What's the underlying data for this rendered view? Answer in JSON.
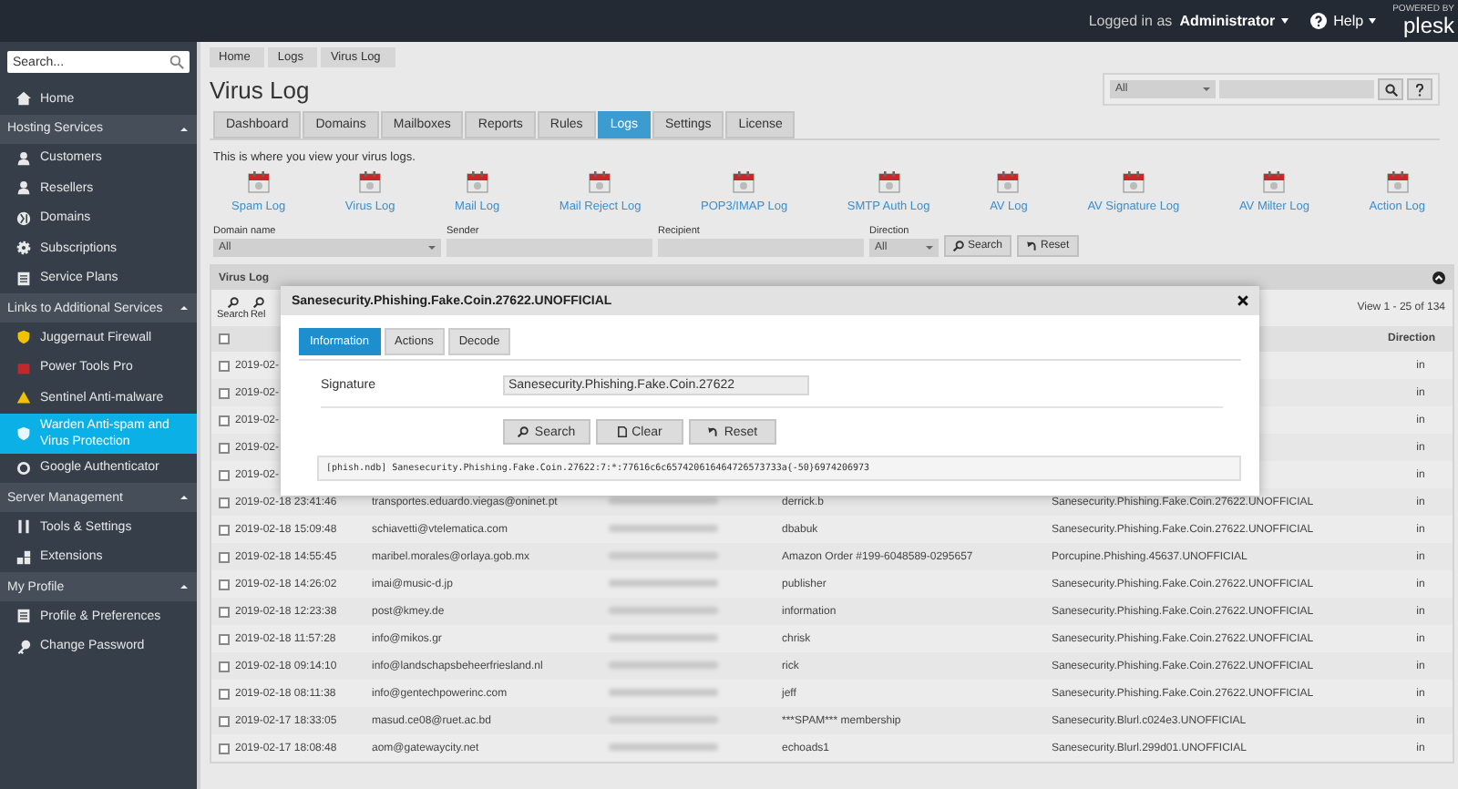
{
  "topbar": {
    "logged_in_label": "Logged in as",
    "user": "Administrator",
    "help": "Help",
    "logo_caption": "POWERED BY",
    "logo": "plesk"
  },
  "sidebar": {
    "search_placeholder": "Search...",
    "items": [
      {
        "kind": "item",
        "label": "Home",
        "selected": false
      },
      {
        "kind": "section",
        "label": "Hosting Services",
        "expanded": true
      },
      {
        "kind": "item",
        "label": "Customers",
        "selected": false
      },
      {
        "kind": "item",
        "label": "Resellers",
        "selected": false
      },
      {
        "kind": "item",
        "label": "Domains",
        "selected": false
      },
      {
        "kind": "item",
        "label": "Subscriptions",
        "selected": false
      },
      {
        "kind": "item",
        "label": "Service Plans",
        "selected": false
      },
      {
        "kind": "section",
        "label": "Links to Additional Services",
        "expanded": true
      },
      {
        "kind": "item",
        "label": "Juggernaut Firewall",
        "selected": false
      },
      {
        "kind": "item",
        "label": "Power Tools Pro",
        "selected": false
      },
      {
        "kind": "item",
        "label": "Sentinel Anti-malware",
        "selected": false
      },
      {
        "kind": "item",
        "label": "Warden Anti-spam and Virus Protection",
        "selected": true
      },
      {
        "kind": "item",
        "label": "Google Authenticator",
        "selected": false
      },
      {
        "kind": "section",
        "label": "Server Management",
        "expanded": true
      },
      {
        "kind": "item",
        "label": "Tools & Settings",
        "selected": false
      },
      {
        "kind": "item",
        "label": "Extensions",
        "selected": false
      },
      {
        "kind": "section",
        "label": "My Profile",
        "expanded": true
      },
      {
        "kind": "item",
        "label": "Profile & Preferences",
        "selected": false
      },
      {
        "kind": "item",
        "label": "Change Password",
        "selected": false
      }
    ]
  },
  "breadcrumb": [
    "Home",
    "Logs",
    "Virus Log"
  ],
  "title": "Virus Log",
  "top_search": {
    "select_value": "All"
  },
  "tabs": [
    {
      "label": "Dashboard",
      "selected": false
    },
    {
      "label": "Domains",
      "selected": false
    },
    {
      "label": "Mailboxes",
      "selected": false
    },
    {
      "label": "Reports",
      "selected": false
    },
    {
      "label": "Rules",
      "selected": false
    },
    {
      "label": "Logs",
      "selected": true
    },
    {
      "label": "Settings",
      "selected": false
    },
    {
      "label": "License",
      "selected": false
    }
  ],
  "description": "This is where you view your virus logs.",
  "log_links": [
    "Spam Log",
    "Virus Log",
    "Mail Log",
    "Mail Reject Log",
    "POP3/IMAP Log",
    "SMTP Auth Log",
    "AV Log",
    "AV Signature Log",
    "AV Milter Log",
    "Action Log"
  ],
  "filters": [
    {
      "kind": "select",
      "label": "Domain name",
      "value": "All"
    },
    {
      "kind": "text",
      "label": "Sender"
    },
    {
      "kind": "text",
      "label": "Recipient"
    },
    {
      "kind": "select",
      "label": "Direction",
      "value": "All"
    }
  ],
  "filter_buttons": [
    "Search",
    "Reset"
  ],
  "table": {
    "title": "Virus Log",
    "toolbar": [
      "Search",
      "Rel"
    ],
    "pager": "View 1 - 25 of 134",
    "direction_header": "Direction",
    "select_all_checked": false,
    "rows": [
      {
        "checked": false,
        "date": "2019-02-",
        "direction": "in"
      },
      {
        "checked": false,
        "date": "2019-02-",
        "direction": "in"
      },
      {
        "checked": false,
        "date": "2019-02-",
        "direction": "in"
      },
      {
        "checked": false,
        "date": "2019-02-",
        "direction": "in"
      },
      {
        "checked": false,
        "date": "2019-02-",
        "direction": "in"
      },
      {
        "checked": false,
        "date": "2019-02-18 23:41:46",
        "sender": "transportes.eduardo.viegas@oninet.pt",
        "subject": "derrick.b",
        "virus": "Sanesecurity.Phishing.Fake.Coin.27622.UNOFFICIAL",
        "direction": "in"
      },
      {
        "checked": false,
        "date": "2019-02-18 15:09:48",
        "sender": "schiavetti@vtelematica.com",
        "subject": "dbabuk",
        "virus": "Sanesecurity.Phishing.Fake.Coin.27622.UNOFFICIAL",
        "direction": "in"
      },
      {
        "checked": false,
        "date": "2019-02-18 14:55:45",
        "sender": "maribel.morales@orlaya.gob.mx",
        "subject": "Amazon Order #199-6048589-0295657",
        "virus": "Porcupine.Phishing.45637.UNOFFICIAL",
        "direction": "in"
      },
      {
        "checked": false,
        "date": "2019-02-18 14:26:02",
        "sender": "imai@music-d.jp",
        "subject": "publisher",
        "virus": "Sanesecurity.Phishing.Fake.Coin.27622.UNOFFICIAL",
        "direction": "in"
      },
      {
        "checked": false,
        "date": "2019-02-18 12:23:38",
        "sender": "post@kmey.de",
        "subject": "information",
        "virus": "Sanesecurity.Phishing.Fake.Coin.27622.UNOFFICIAL",
        "direction": "in"
      },
      {
        "checked": false,
        "date": "2019-02-18 11:57:28",
        "sender": "info@mikos.gr",
        "subject": "chrisk",
        "virus": "Sanesecurity.Phishing.Fake.Coin.27622.UNOFFICIAL",
        "direction": "in"
      },
      {
        "checked": false,
        "date": "2019-02-18 09:14:10",
        "sender": "info@landschapsbeheerfriesland.nl",
        "subject": "rick",
        "virus": "Sanesecurity.Phishing.Fake.Coin.27622.UNOFFICIAL",
        "direction": "in"
      },
      {
        "checked": false,
        "date": "2019-02-18 08:11:38",
        "sender": "info@gentechpowerinc.com",
        "subject": "jeff",
        "virus": "Sanesecurity.Phishing.Fake.Coin.27622.UNOFFICIAL",
        "direction": "in"
      },
      {
        "checked": false,
        "date": "2019-02-17 18:33:05",
        "sender": "masud.ce08@ruet.ac.bd",
        "subject": "***SPAM*** membership",
        "virus": "Sanesecurity.Blurl.c024e3.UNOFFICIAL",
        "direction": "in"
      },
      {
        "checked": false,
        "date": "2019-02-17 18:08:48",
        "sender": "aom@gatewaycity.net",
        "subject": "echoads1",
        "virus": "Sanesecurity.Blurl.299d01.UNOFFICIAL",
        "direction": "in"
      }
    ]
  },
  "dialog": {
    "title": "Sanesecurity.Phishing.Fake.Coin.27622.UNOFFICIAL",
    "tabs": [
      {
        "label": "Information",
        "selected": true
      },
      {
        "label": "Actions",
        "selected": false
      },
      {
        "label": "Decode",
        "selected": false
      }
    ],
    "field_label": "Signature",
    "field_value": "Sanesecurity.Phishing.Fake.Coin.27622",
    "buttons": [
      "Search",
      "Clear",
      "Reset"
    ],
    "code": "[phish.ndb] Sanesecurity.Phishing.Fake.Coin.27622:7:*:77616c6c657420616464726573733a{-50}6974206973"
  }
}
